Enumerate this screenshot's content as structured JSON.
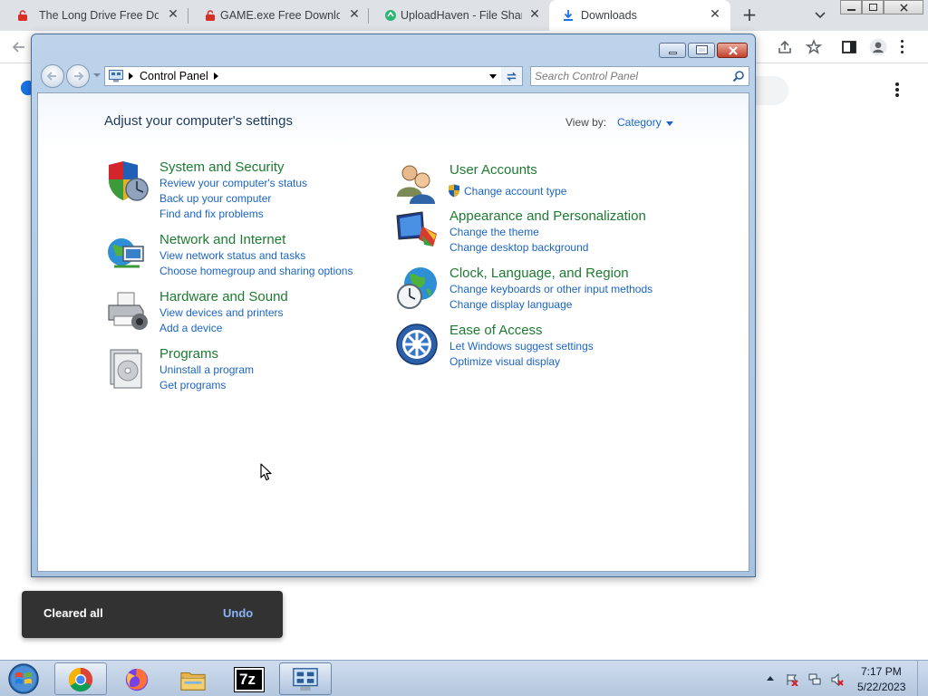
{
  "browser": {
    "tabs": [
      {
        "title": "The Long Drive Free Dow",
        "favicon": "red-lock-icon"
      },
      {
        "title": "GAME.exe Free Downloac",
        "favicon": "red-lock-icon"
      },
      {
        "title": "UploadHaven - File Sharin",
        "favicon": "uploadhaven-icon"
      },
      {
        "title": "Downloads",
        "favicon": "download-icon"
      }
    ],
    "new_tab_label": "+",
    "close_glyph": "✕"
  },
  "snackbar": {
    "message": "Cleared all",
    "action": "Undo"
  },
  "control_panel": {
    "breadcrumb": "Control Panel",
    "search_placeholder": "Search Control Panel",
    "heading": "Adjust your computer's settings",
    "view_by_label": "View by:",
    "view_by_value": "Category",
    "left_categories": [
      {
        "title": "System and Security",
        "links": [
          "Review your computer's status",
          "Back up your computer",
          "Find and fix problems"
        ]
      },
      {
        "title": "Network and Internet",
        "links": [
          "View network status and tasks",
          "Choose homegroup and sharing options"
        ]
      },
      {
        "title": "Hardware and Sound",
        "links": [
          "View devices and printers",
          "Add a device"
        ]
      },
      {
        "title": "Programs",
        "links": [
          "Uninstall a program",
          "Get programs"
        ]
      }
    ],
    "right_categories": [
      {
        "title": "User Accounts",
        "links": [
          "Change account type"
        ]
      },
      {
        "title": "Appearance and Personalization",
        "links": [
          "Change the theme",
          "Change desktop background"
        ]
      },
      {
        "title": "Clock, Language, and Region",
        "links": [
          "Change keyboards or other input methods",
          "Change display language"
        ]
      },
      {
        "title": "Ease of Access",
        "links": [
          "Let Windows suggest settings",
          "Optimize visual display"
        ]
      }
    ]
  },
  "taskbar": {
    "apps": [
      "chrome-icon",
      "firefox-icon",
      "file-explorer-icon",
      "7zip-icon",
      "control-panel-icon"
    ],
    "seven_zip_label": "7z",
    "time": "7:17 PM",
    "date": "5/22/2023"
  },
  "colors": {
    "category_title": "#1e7a32",
    "link": "#1b64c4",
    "heading": "#1e395b",
    "snackbar_bg": "#323232",
    "snackbar_action": "#8ab4f8"
  }
}
